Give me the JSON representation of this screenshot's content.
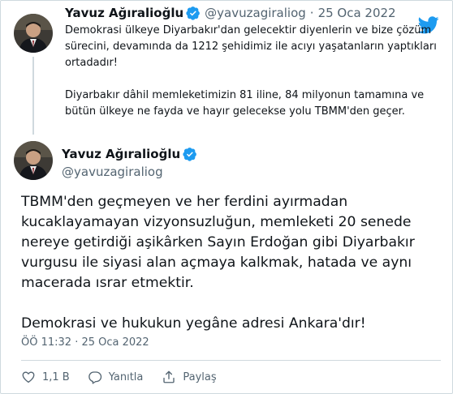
{
  "colors": {
    "accent": "#1d9bf0",
    "text": "#0f1419",
    "muted": "#536471",
    "border": "#cfd9de"
  },
  "parent_tweet": {
    "author_name": "Yavuz Ağıralioğlu",
    "handle": "@yavuzagiraliog",
    "separator": "·",
    "date": "25 Oca 2022",
    "paragraphs": [
      "Demokrasi ülkeye Diyarbakır'dan gelecektir diyenlerin ve bize çözüm\nsürecini, devamında da 1212 şehidimiz ile acıyı yaşatanların yaptıkları\nortadadır!",
      "Diyarbakır dâhil memleketimizin 81 iline, 84 milyonun tamamına ve\nbütün ülkeye ne fayda ve hayır gelecekse yolu TBMM'den geçer."
    ]
  },
  "main_tweet": {
    "author_name": "Yavuz Ağıralioğlu",
    "handle": "@yavuzagiraliog",
    "paragraphs": [
      "TBMM'den geçmeyen ve her ferdini ayırmadan\nkucaklayamayan vizyonsuzluğun, memleketi 20 senede\nnereye getirdiği aşikârken Sayın Erdoğan gibi Diyarbakır\nvurgusu ile siyasi alan açmaya kalkmak, hatada ve aynı\nmacerada ısrar etmektir.",
      "Demokrasi ve hukukun yegâne adresi Ankara'dır!"
    ],
    "timestamp": "ÖÖ 11:32 · 25 Oca 2022"
  },
  "actions": {
    "like": {
      "icon": "heart-icon",
      "count": "1,1 B"
    },
    "reply": {
      "icon": "reply-icon",
      "label": "Yanıtla"
    },
    "share": {
      "icon": "share-icon",
      "label": "Paylaş"
    }
  },
  "icons": {
    "verified": "verified-badge-icon",
    "logo": "twitter-bird-icon"
  }
}
